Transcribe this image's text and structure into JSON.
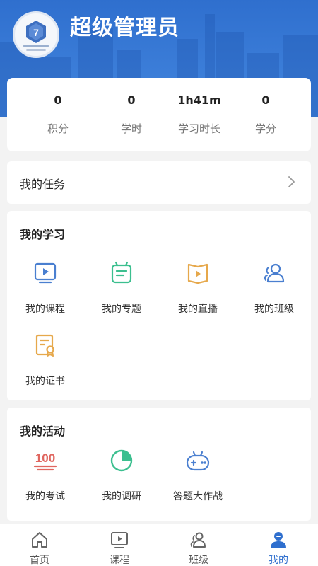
{
  "user": {
    "name": "超级管理员"
  },
  "stats": [
    {
      "value": "0",
      "label": "积分"
    },
    {
      "value": "0",
      "label": "学时"
    },
    {
      "value": "1h41m",
      "label": "学习时长"
    },
    {
      "value": "0",
      "label": "学分"
    }
  ],
  "task": {
    "title": "我的任务"
  },
  "study": {
    "title": "我的学习",
    "items": [
      {
        "label": "我的课程",
        "icon": "video-screen-icon"
      },
      {
        "label": "我的专题",
        "icon": "alarm-list-icon"
      },
      {
        "label": "我的直播",
        "icon": "live-book-icon"
      },
      {
        "label": "我的班级",
        "icon": "group-users-icon"
      },
      {
        "label": "我的证书",
        "icon": "certificate-icon"
      }
    ]
  },
  "activity": {
    "title": "我的活动",
    "items": [
      {
        "label": "我的考试",
        "icon": "score-100-icon"
      },
      {
        "label": "我的调研",
        "icon": "pie-chart-icon"
      },
      {
        "label": "答题大作战",
        "icon": "gamepad-icon"
      }
    ]
  },
  "tabbar": {
    "items": [
      {
        "label": "首页",
        "icon": "home-icon"
      },
      {
        "label": "课程",
        "icon": "course-play-icon"
      },
      {
        "label": "班级",
        "icon": "class-users-icon"
      },
      {
        "label": "我的",
        "icon": "profile-icon",
        "active": true
      }
    ]
  },
  "colors": {
    "brand_blue": "#2f6fce",
    "icon_blue": "#4a7fd0",
    "icon_green": "#3cbf8f",
    "icon_orange": "#e6a84b",
    "icon_red": "#e0665f"
  }
}
